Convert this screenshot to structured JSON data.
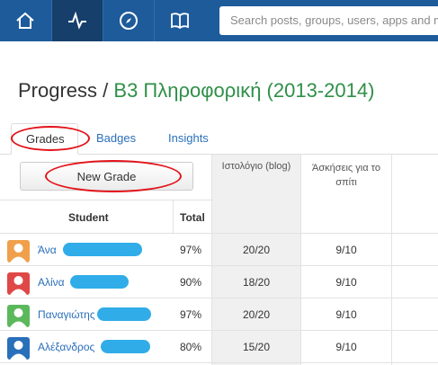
{
  "search": {
    "placeholder": "Search posts, groups, users, apps and more"
  },
  "page": {
    "title_prefix": "Progress",
    "title_sep": " / ",
    "title_course": "Β3 Πληροφορική (2013-2014)"
  },
  "tabs": [
    "Grades",
    "Badges",
    "Insights"
  ],
  "new_grade_label": "New Grade",
  "columns": {
    "blog": "Ιστολόγιο (blog)",
    "exercises_l1": "Άσκήσεις για το",
    "exercises_l2": "σπίτι",
    "student": "Student",
    "total": "Total"
  },
  "rows": [
    {
      "name": "Άνα",
      "total": "97%",
      "blog": "20/20",
      "exercises": "9/10",
      "avatar_color": "#f0a04b"
    },
    {
      "name": "Αλίνα",
      "total": "90%",
      "blog": "18/20",
      "exercises": "9/10",
      "avatar_color": "#e04848"
    },
    {
      "name": "Παναγιώτης",
      "total": "97%",
      "blog": "20/20",
      "exercises": "9/10",
      "avatar_color": "#5cb85c"
    },
    {
      "name": "Αλέξανδρος",
      "total": "80%",
      "blog": "15/20",
      "exercises": "9/10",
      "avatar_color": "#2a6fba"
    }
  ],
  "colors": {
    "topbar": "#1d5b9b",
    "link": "#2a6fba",
    "course": "#2f8f48",
    "annotation": "#e3131a"
  }
}
